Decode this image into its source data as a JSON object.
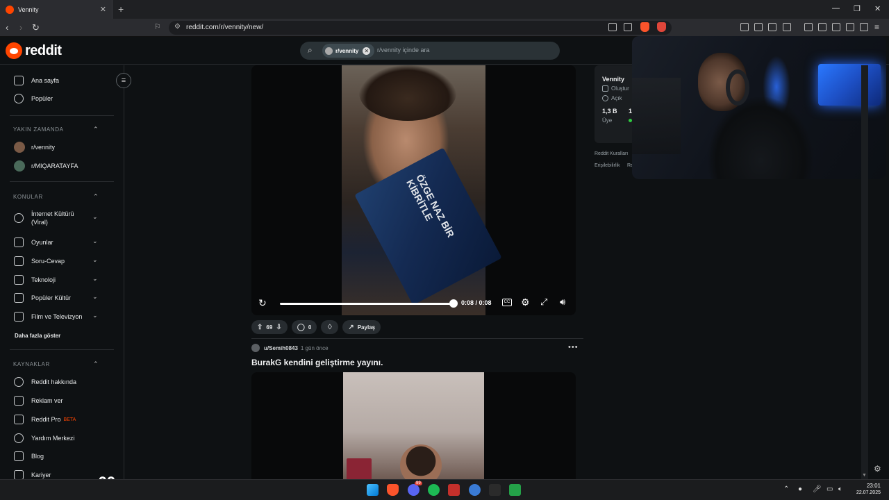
{
  "browser": {
    "tab_title": "Vennity",
    "url": "reddit.com/r/vennity/new/"
  },
  "header": {
    "logo_text": "reddit",
    "search_chip": "r/vennity",
    "search_placeholder": "r/vennity içinde ara"
  },
  "sidebar": {
    "main": [
      {
        "label": "Ana sayfa",
        "icon": "home-icon"
      },
      {
        "label": "Popüler",
        "icon": "popular-icon"
      }
    ],
    "recent_heading": "YAKIN ZAMANDA",
    "recent": [
      {
        "label": "r/vennity"
      },
      {
        "label": "r/MIQARATAYFA"
      }
    ],
    "topics_heading": "KONULAR",
    "topics": [
      {
        "label": "İnternet Kültürü (Viral)",
        "icon": "smile-icon"
      },
      {
        "label": "Oyunlar",
        "icon": "gamepad-icon"
      },
      {
        "label": "Soru-Cevap",
        "icon": "question-icon"
      },
      {
        "label": "Teknoloji",
        "icon": "chip-icon"
      },
      {
        "label": "Popüler Kültür",
        "icon": "ticket-icon"
      },
      {
        "label": "Film ve Televizyon",
        "icon": "clapper-icon"
      }
    ],
    "show_more": "Daha fazla göster",
    "resources_heading": "KAYNAKLAR",
    "resources": [
      {
        "label": "Reddit hakkında",
        "icon": "reddit-icon"
      },
      {
        "label": "Reklam ver",
        "icon": "megaphone-icon"
      },
      {
        "label": "Reddit Pro",
        "icon": "chart-icon",
        "badge": "BETA"
      },
      {
        "label": "Yardım Merkezi",
        "icon": "help-icon"
      },
      {
        "label": "Blog",
        "icon": "book-icon"
      },
      {
        "label": "Kariyer",
        "icon": "wrench-icon"
      }
    ]
  },
  "post1": {
    "video_time": "0:08 / 0:08",
    "progress": 1.0,
    "votes": "69",
    "comments": "0",
    "share": "Paylaş",
    "book_title": "ÖZGE NAZ BİR KİBRİTLE"
  },
  "post2": {
    "user": "u/Semih0843",
    "time_ago": "1 gün önce",
    "title": "BurakG kendini geliştirme yayını."
  },
  "right_panel": {
    "name": "Vennity",
    "created": "Oluştur",
    "visibility": "Açık",
    "members": "1,3 B",
    "online": "1",
    "members_label": "Üye",
    "rules_link": "Reddit Kuralları",
    "a11y_link": "Erişilebilirlik",
    "a11y_link2": "Rea"
  },
  "taskbar": {
    "time": "23:01",
    "date": "22.07.2025",
    "overlay_number": "88",
    "discord_badge": "99"
  }
}
